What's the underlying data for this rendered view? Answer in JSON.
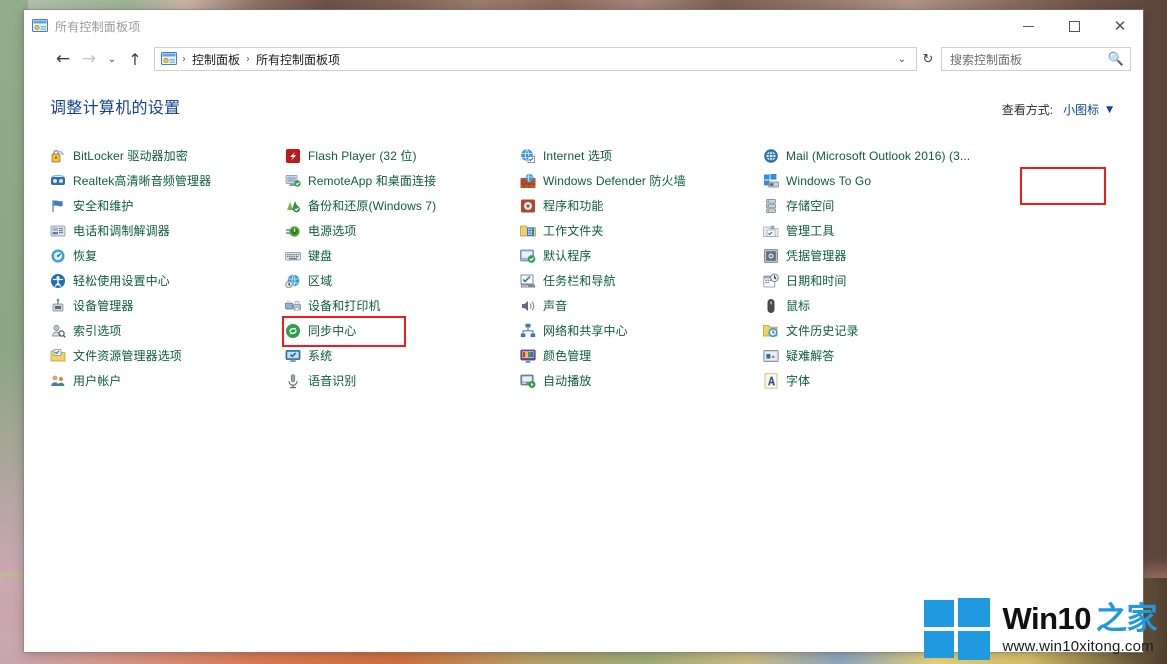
{
  "window": {
    "title": "所有控制面板项",
    "title_icon": "control-panel-icon",
    "controls": {
      "minimize": "—",
      "maximize": "□",
      "close": "✕"
    }
  },
  "navbar": {
    "back": "←",
    "forward": "→",
    "recent": "⌄",
    "up": "↑",
    "breadcrumb": [
      "控制面板",
      "所有控制面板项"
    ],
    "separator": "›",
    "address_chevron": "⌄",
    "refresh": "↻",
    "search": {
      "placeholder": "搜索控制面板",
      "icon": "search-icon"
    }
  },
  "content": {
    "page_title": "调整计算机的设置",
    "view_mode": {
      "label": "查看方式:",
      "value": "小图标",
      "caret": "▼"
    }
  },
  "highlights": {
    "view_mode_box_color": "#ee1c1c",
    "power_options_box_color": "#ee1c1c"
  },
  "columns": [
    {
      "items": [
        {
          "label": "BitLocker 驱动器加密",
          "icon": "bitlocker-icon"
        },
        {
          "label": "Realtek高清晰音频管理器",
          "icon": "realtek-audio-icon"
        },
        {
          "label": "安全和维护",
          "icon": "flag-icon"
        },
        {
          "label": "电话和调制解调器",
          "icon": "phone-modem-icon"
        },
        {
          "label": "恢复",
          "icon": "recovery-icon"
        },
        {
          "label": "轻松使用设置中心",
          "icon": "ease-of-access-icon"
        },
        {
          "label": "设备管理器",
          "icon": "device-manager-icon"
        },
        {
          "label": "索引选项",
          "icon": "indexing-options-icon"
        },
        {
          "label": "文件资源管理器选项",
          "icon": "folder-options-icon"
        },
        {
          "label": "用户帐户",
          "icon": "user-accounts-icon"
        }
      ]
    },
    {
      "items": [
        {
          "label": "Flash Player (32 位)",
          "icon": "flash-player-icon"
        },
        {
          "label": "RemoteApp 和桌面连接",
          "icon": "remoteapp-icon"
        },
        {
          "label": "备份和还原(Windows 7)",
          "icon": "backup-restore-icon"
        },
        {
          "label": "电源选项",
          "icon": "power-options-icon"
        },
        {
          "label": "键盘",
          "icon": "keyboard-icon"
        },
        {
          "label": "区域",
          "icon": "region-icon"
        },
        {
          "label": "设备和打印机",
          "icon": "devices-printers-icon"
        },
        {
          "label": "同步中心",
          "icon": "sync-center-icon"
        },
        {
          "label": "系统",
          "icon": "system-icon"
        },
        {
          "label": "语音识别",
          "icon": "speech-recognition-icon"
        }
      ]
    },
    {
      "items": [
        {
          "label": "Internet 选项",
          "icon": "internet-options-icon"
        },
        {
          "label": "Windows Defender 防火墙",
          "icon": "firewall-icon"
        },
        {
          "label": "程序和功能",
          "icon": "programs-features-icon"
        },
        {
          "label": "工作文件夹",
          "icon": "work-folders-icon"
        },
        {
          "label": "默认程序",
          "icon": "default-programs-icon"
        },
        {
          "label": "任务栏和导航",
          "icon": "taskbar-navigation-icon"
        },
        {
          "label": "声音",
          "icon": "sound-icon"
        },
        {
          "label": "网络和共享中心",
          "icon": "network-sharing-icon"
        },
        {
          "label": "颜色管理",
          "icon": "color-management-icon"
        },
        {
          "label": "自动播放",
          "icon": "autoplay-icon"
        }
      ]
    },
    {
      "items": [
        {
          "label": "Mail (Microsoft Outlook 2016) (3...",
          "icon": "mail-icon"
        },
        {
          "label": "Windows To Go",
          "icon": "windows-to-go-icon"
        },
        {
          "label": "存储空间",
          "icon": "storage-spaces-icon"
        },
        {
          "label": "管理工具",
          "icon": "admin-tools-icon"
        },
        {
          "label": "凭据管理器",
          "icon": "credential-manager-icon"
        },
        {
          "label": "日期和时间",
          "icon": "date-time-icon"
        },
        {
          "label": "鼠标",
          "icon": "mouse-icon"
        },
        {
          "label": "文件历史记录",
          "icon": "file-history-icon"
        },
        {
          "label": "疑难解答",
          "icon": "troubleshooting-icon"
        },
        {
          "label": "字体",
          "icon": "fonts-icon"
        }
      ]
    }
  ],
  "watermark": {
    "brand_en": "Win10",
    "brand_cn": "之家",
    "url": "www.win10xitong.com",
    "logo": "windows-logo",
    "logo_color": "#1f9ae0"
  }
}
